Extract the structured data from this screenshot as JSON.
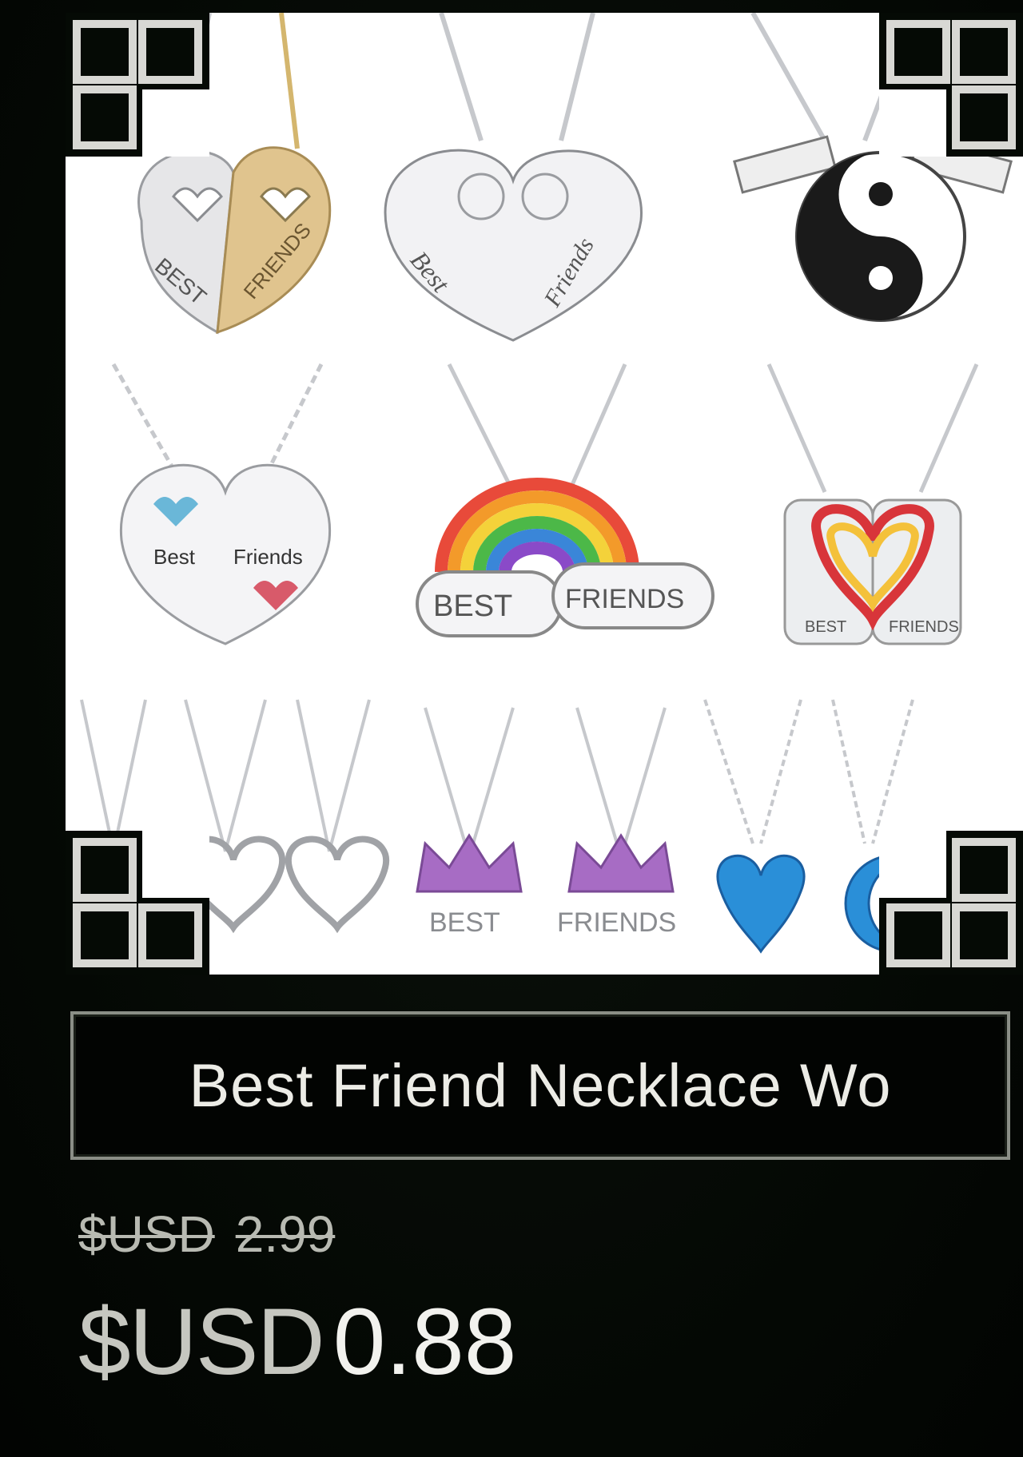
{
  "product": {
    "title": "Best Friend Necklace Wo",
    "image_alt": "Best friend necklaces collage",
    "image_texts": [
      "BEST",
      "FRIENDS",
      "Best",
      "Friends",
      "Best",
      "Friends",
      "BEST",
      "FRIENDS",
      "BEST",
      "FRIENDS",
      "BEST",
      "FRIENDS"
    ]
  },
  "price": {
    "old_currency": "$USD",
    "old_amount": "2.99",
    "new_currency": "$USD",
    "new_amount": "0.88"
  },
  "colors": {
    "background": "#050a05",
    "frame": "#ffffff",
    "title_border": "#8a8e86",
    "text": "#ecece6"
  }
}
